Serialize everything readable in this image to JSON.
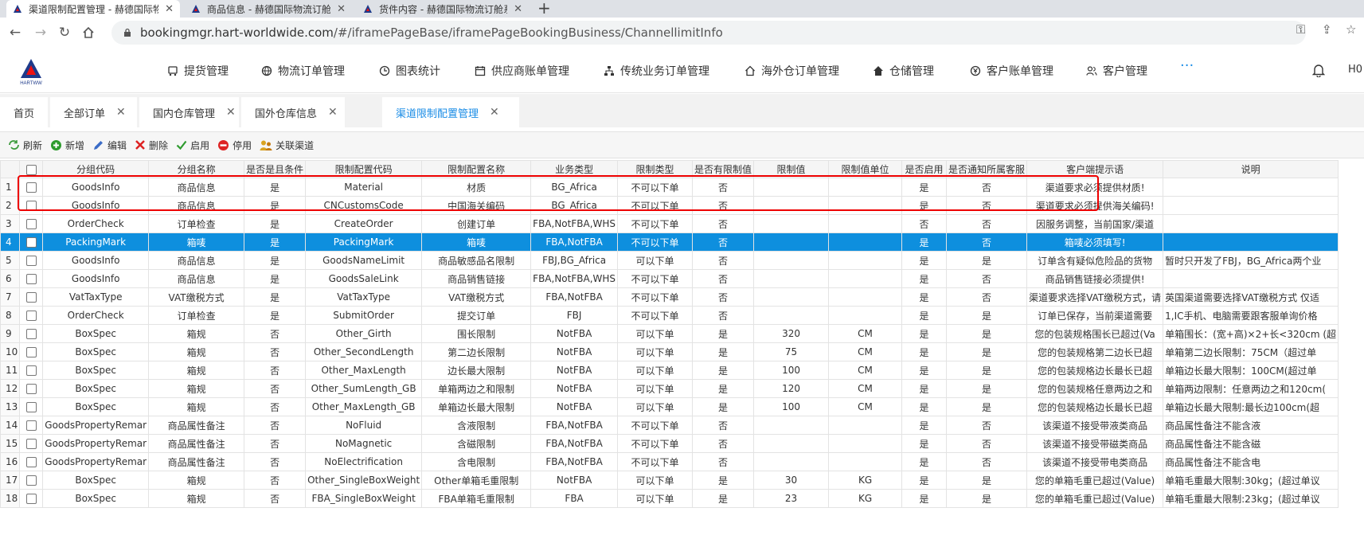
{
  "browser": {
    "tabs": [
      {
        "title": "渠道限制配置管理 - 赫德国际物流"
      },
      {
        "title": "商品信息 - 赫德国际物流订舱系统"
      },
      {
        "title": "货件内容 - 赫德国际物流订舱系统"
      }
    ],
    "url_host": "bookingmgr.hart-worldwide.com",
    "url_path": "/#/iframePageBase/iframePageBookingBusiness/ChannellimitInfo"
  },
  "header": {
    "logo_text": "HARTWW",
    "menu": [
      "提货管理",
      "物流订单管理",
      "图表统计",
      "供应商账单管理",
      "传统业务订单管理",
      "海外仓订单管理",
      "仓储管理",
      "客户账单管理",
      "客户管理"
    ],
    "more": "···",
    "user": "H0"
  },
  "pagetabs": [
    "首页",
    "全部订单",
    "国内仓库管理",
    "国外仓库信息",
    "渠道限制配置管理"
  ],
  "toolbar": [
    "刷新",
    "新增",
    "编辑",
    "删除",
    "启用",
    "停用",
    "关联渠道"
  ],
  "grid": {
    "columns": [
      "分组代码",
      "分组名称",
      "是否是且条件",
      "限制配置代码",
      "限制配置名称",
      "业务类型",
      "限制类型",
      "是否有限制值",
      "限制值",
      "限制值单位",
      "是否启用",
      "是否通知所属客服",
      "客户端提示语",
      "说明"
    ],
    "rows": [
      [
        "1",
        "GoodsInfo",
        "商品信息",
        "是",
        "Material",
        "材质",
        "BG_Africa",
        "不可以下单",
        "否",
        "",
        "",
        "是",
        "否",
        "渠道要求必须提供材质!",
        ""
      ],
      [
        "2",
        "GoodsInfo",
        "商品信息",
        "是",
        "CNCustomsCode",
        "中国海关编码",
        "BG_Africa",
        "不可以下单",
        "否",
        "",
        "",
        "是",
        "否",
        "渠道要求必须提供海关编码!",
        ""
      ],
      [
        "3",
        "OrderCheck",
        "订单检查",
        "是",
        "CreateOrder",
        "创建订单",
        "FBA,NotFBA,WHS",
        "不可以下单",
        "否",
        "",
        "",
        "否",
        "否",
        "因服务调整，当前国家/渠道",
        ""
      ],
      [
        "4",
        "PackingMark",
        "箱唛",
        "是",
        "PackingMark",
        "箱唛",
        "FBA,NotFBA",
        "不可以下单",
        "否",
        "",
        "",
        "是",
        "否",
        "箱唛必须填写!",
        ""
      ],
      [
        "5",
        "GoodsInfo",
        "商品信息",
        "是",
        "GoodsNameLimit",
        "商品敏感品名限制",
        "FBJ,BG_Africa",
        "可以下单",
        "否",
        "",
        "",
        "是",
        "是",
        "订单含有疑似危险品的货物",
        "暂时只开发了FBJ，BG_Africa两个业"
      ],
      [
        "6",
        "GoodsInfo",
        "商品信息",
        "是",
        "GoodsSaleLink",
        "商品销售链接",
        "FBA,NotFBA,WHS",
        "不可以下单",
        "否",
        "",
        "",
        "是",
        "否",
        "商品销售链接必须提供!",
        ""
      ],
      [
        "7",
        "VatTaxType",
        "VAT缴税方式",
        "是",
        "VatTaxType",
        "VAT缴税方式",
        "FBA,NotFBA",
        "不可以下单",
        "否",
        "",
        "",
        "是",
        "否",
        "渠道要求选择VAT缴税方式，请",
        "英国渠道需要选择VAT缴税方式 仅适"
      ],
      [
        "8",
        "OrderCheck",
        "订单检查",
        "是",
        "SubmitOrder",
        "提交订单",
        "FBJ",
        "不可以下单",
        "否",
        "",
        "",
        "是",
        "是",
        "订单已保存，当前渠道需要",
        "1,IC手机、电脑需要跟客服单询价格"
      ],
      [
        "9",
        "BoxSpec",
        "箱规",
        "否",
        "Other_Girth",
        "围长限制",
        "NotFBA",
        "可以下单",
        "是",
        "320",
        "CM",
        "是",
        "是",
        "您的包装规格围长已超过(Va",
        "单箱围长：(宽+高)×2+长<320cm (超"
      ],
      [
        "10",
        "BoxSpec",
        "箱规",
        "否",
        "Other_SecondLength",
        "第二边长限制",
        "NotFBA",
        "可以下单",
        "是",
        "75",
        "CM",
        "是",
        "是",
        "您的包装规格第二边长已超",
        "单箱第二边长限制：75CM（超过单"
      ],
      [
        "11",
        "BoxSpec",
        "箱规",
        "否",
        "Other_MaxLength",
        "边长最大限制",
        "NotFBA",
        "可以下单",
        "是",
        "100",
        "CM",
        "是",
        "是",
        "您的包装规格边长最长已超",
        "单箱边长最大限制：100CM(超过单"
      ],
      [
        "12",
        "BoxSpec",
        "箱规",
        "否",
        "Other_SumLength_GB",
        "单箱两边之和限制",
        "NotFBA",
        "可以下单",
        "是",
        "120",
        "CM",
        "是",
        "是",
        "您的包装规格任意两边之和",
        "单箱两边限制：任意两边之和120cm("
      ],
      [
        "13",
        "BoxSpec",
        "箱规",
        "否",
        "Other_MaxLength_GB",
        "单箱边长最大限制",
        "NotFBA",
        "可以下单",
        "是",
        "100",
        "CM",
        "是",
        "是",
        "您的包装规格边长最长已超",
        "单箱边长最大限制:最长边100cm(超"
      ],
      [
        "14",
        "GoodsPropertyRemar",
        "商品属性备注",
        "否",
        "NoFluid",
        "含液限制",
        "FBA,NotFBA",
        "不可以下单",
        "否",
        "",
        "",
        "是",
        "否",
        "该渠道不接受带液类商品",
        "商品属性备注不能含液"
      ],
      [
        "15",
        "GoodsPropertyRemar",
        "商品属性备注",
        "否",
        "NoMagnetic",
        "含磁限制",
        "FBA,NotFBA",
        "不可以下单",
        "否",
        "",
        "",
        "是",
        "否",
        "该渠道不接受带磁类商品",
        "商品属性备注不能含磁"
      ],
      [
        "16",
        "GoodsPropertyRemar",
        "商品属性备注",
        "否",
        "NoElectrification",
        "含电限制",
        "FBA,NotFBA",
        "不可以下单",
        "否",
        "",
        "",
        "是",
        "否",
        "该渠道不接受带电类商品",
        "商品属性备注不能含电"
      ],
      [
        "17",
        "BoxSpec",
        "箱规",
        "否",
        "Other_SingleBoxWeight",
        "Other单箱毛重限制",
        "NotFBA",
        "可以下单",
        "是",
        "30",
        "KG",
        "是",
        "是",
        "您的单箱毛重已超过(Value)",
        "单箱毛重最大限制:30kg；(超过单议"
      ],
      [
        "18",
        "BoxSpec",
        "箱规",
        "否",
        "FBA_SingleBoxWeight",
        "FBA单箱毛重限制",
        "FBA",
        "可以下单",
        "是",
        "23",
        "KG",
        "是",
        "是",
        "您的单箱毛重已超过(Value)",
        "单箱毛重最大限制:23kg；(超过单议"
      ]
    ],
    "selected_row": 4,
    "highlighted_rows": [
      1,
      2
    ]
  },
  "colors": {
    "accent": "#1a8ce6",
    "selected_row": "#0e8fde",
    "highlight_box": "#ee0000"
  }
}
